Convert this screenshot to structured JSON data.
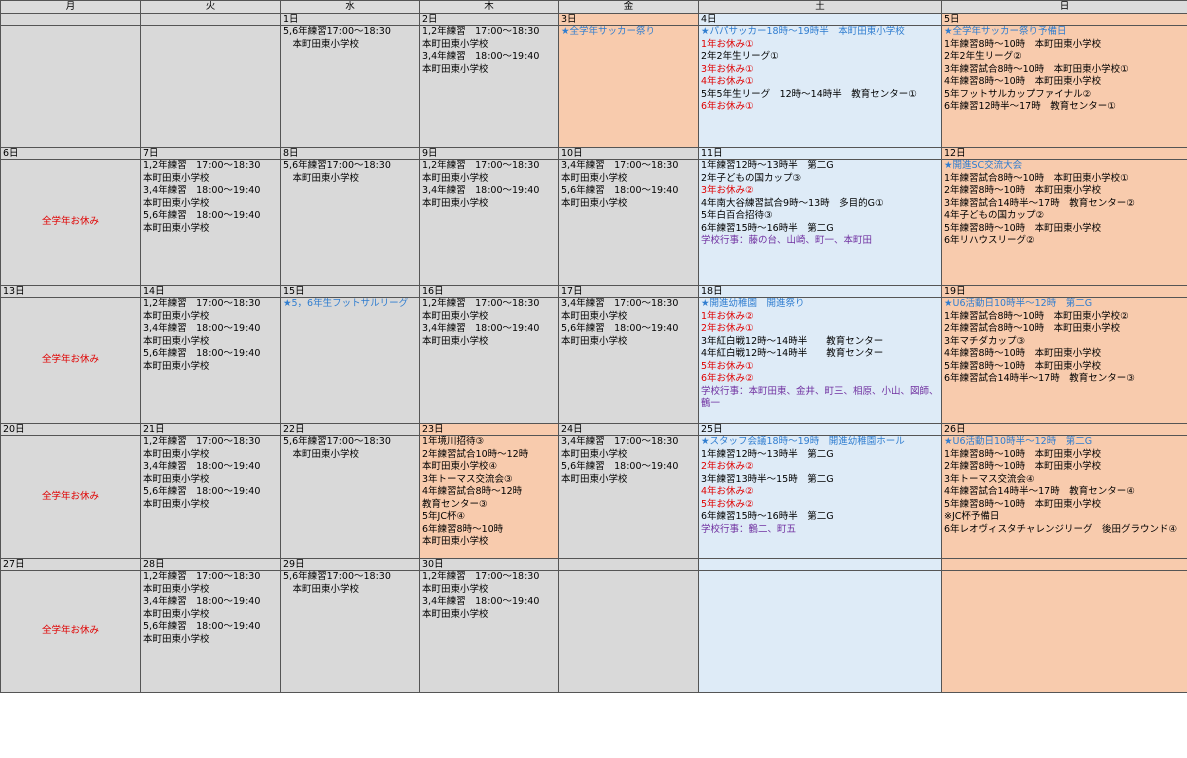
{
  "weekdays": [
    "月",
    "火",
    "水",
    "木",
    "金",
    "土",
    "日"
  ],
  "weeks": [
    {
      "rowHeight": 134,
      "days": [
        {
          "label": "",
          "bg": "gray",
          "lines": []
        },
        {
          "label": "",
          "bg": "gray",
          "lines": []
        },
        {
          "label": "1日",
          "bg": "gray",
          "lines": [
            [
              "5,6年練習17:00～18:30",
              "black"
            ],
            [
              "　本町田東小学校",
              "black"
            ]
          ]
        },
        {
          "label": "2日",
          "bg": "gray",
          "lines": [
            [
              "1,2年練習　17:00～18:30",
              "black"
            ],
            [
              "本町田東小学校",
              "black"
            ],
            [
              "3,4年練習　18:00～19:40",
              "black"
            ],
            [
              "本町田東小学校",
              "black"
            ]
          ]
        },
        {
          "label": "3日",
          "bg": "orange",
          "lines": [
            [
              "★全学年サッカー祭り",
              "blue"
            ]
          ]
        },
        {
          "label": "4日",
          "bg": "blue",
          "lines": [
            [
              "★パパサッカー18時～19時半　本町田東小学校",
              "blue"
            ],
            [
              "1年お休み①",
              "red"
            ],
            [
              "2年2年生リーグ①",
              "black"
            ],
            [
              "3年お休み①",
              "red"
            ],
            [
              "4年お休み①",
              "red"
            ],
            [
              "5年5年生リーグ　12時～14時半　教育センター①",
              "black"
            ],
            [
              "6年お休み①",
              "red"
            ]
          ]
        },
        {
          "label": "5日",
          "bg": "orange",
          "lines": [
            [
              "★全学年サッカー祭り予備日",
              "blue"
            ],
            [
              "1年練習8時～10時　本町田東小学校",
              "black"
            ],
            [
              "2年2年生リーグ②",
              "black"
            ],
            [
              "3年練習試合8時～10時　本町田東小学校①",
              "black"
            ],
            [
              "4年練習8時～10時　本町田東小学校",
              "black"
            ],
            [
              "5年フットサルカップファイナル②",
              "black"
            ],
            [
              "6年練習12時半～17時　教育センター①",
              "black"
            ]
          ]
        }
      ]
    },
    {
      "rowHeight": 138,
      "days": [
        {
          "label": "6日",
          "bg": "gray",
          "center": "全学年お休み",
          "lines": []
        },
        {
          "label": "7日",
          "bg": "gray",
          "lines": [
            [
              "1,2年練習　17:00～18:30",
              "black"
            ],
            [
              "本町田東小学校",
              "black"
            ],
            [
              "3,4年練習　18:00～19:40",
              "black"
            ],
            [
              "本町田東小学校",
              "black"
            ],
            [
              "5,6年練習　18:00～19:40",
              "black"
            ],
            [
              "本町田東小学校",
              "black"
            ]
          ]
        },
        {
          "label": "8日",
          "bg": "gray",
          "lines": [
            [
              "5,6年練習17:00～18:30",
              "black"
            ],
            [
              "　本町田東小学校",
              "black"
            ]
          ]
        },
        {
          "label": "9日",
          "bg": "gray",
          "lines": [
            [
              "1,2年練習　17:00～18:30",
              "black"
            ],
            [
              "本町田東小学校",
              "black"
            ],
            [
              "3,4年練習　18:00～19:40",
              "black"
            ],
            [
              "本町田東小学校",
              "black"
            ]
          ]
        },
        {
          "label": "10日",
          "bg": "gray",
          "lines": [
            [
              "3,4年練習　17:00～18:30",
              "black"
            ],
            [
              "本町田東小学校",
              "black"
            ],
            [
              "5,6年練習　18:00～19:40",
              "black"
            ],
            [
              "本町田東小学校",
              "black"
            ]
          ]
        },
        {
          "label": "11日",
          "bg": "blue",
          "lines": [
            [
              "1年練習12時～13時半　第二G",
              "black"
            ],
            [
              "2年子どもの国カップ③",
              "black"
            ],
            [
              "3年お休み②",
              "red"
            ],
            [
              "4年南大谷練習試合9時～13時　多目的G①",
              "black"
            ],
            [
              "5年白百合招待③",
              "black"
            ],
            [
              "6年練習15時～16時半　第二G",
              "black"
            ],
            [
              "学校行事：藤の台、山崎、町一、本町田",
              "purple"
            ]
          ]
        },
        {
          "label": "12日",
          "bg": "orange",
          "lines": [
            [
              "★開進SC交流大会",
              "blue"
            ],
            [
              "1年練習試合8時～10時　本町田東小学校①",
              "black"
            ],
            [
              "2年練習8時～10時　本町田東小学校",
              "black"
            ],
            [
              "3年練習試合14時半～17時　教育センター②",
              "black"
            ],
            [
              "4年子どもの国カップ②",
              "black"
            ],
            [
              "5年練習8時～10時　本町田東小学校",
              "black"
            ],
            [
              "6年リハウスリーグ②",
              "black"
            ]
          ]
        }
      ]
    },
    {
      "rowHeight": 138,
      "days": [
        {
          "label": "13日",
          "bg": "gray",
          "center": "全学年お休み",
          "lines": []
        },
        {
          "label": "14日",
          "bg": "gray",
          "lines": [
            [
              "1,2年練習　17:00～18:30",
              "black"
            ],
            [
              "本町田東小学校",
              "black"
            ],
            [
              "3,4年練習　18:00～19:40",
              "black"
            ],
            [
              "本町田東小学校",
              "black"
            ],
            [
              "5,6年練習　18:00～19:40",
              "black"
            ],
            [
              "本町田東小学校",
              "black"
            ]
          ]
        },
        {
          "label": "15日",
          "bg": "gray",
          "lines": [
            [
              "★5，6年生フットサルリーグ",
              "blue"
            ]
          ]
        },
        {
          "label": "16日",
          "bg": "gray",
          "lines": [
            [
              "1,2年練習　17:00～18:30",
              "black"
            ],
            [
              "本町田東小学校",
              "black"
            ],
            [
              "3,4年練習　18:00～19:40",
              "black"
            ],
            [
              "本町田東小学校",
              "black"
            ]
          ]
        },
        {
          "label": "17日",
          "bg": "gray",
          "lines": [
            [
              "3,4年練習　17:00～18:30",
              "black"
            ],
            [
              "本町田東小学校",
              "black"
            ],
            [
              "5,6年練習　18:00～19:40",
              "black"
            ],
            [
              "本町田東小学校",
              "black"
            ]
          ]
        },
        {
          "label": "18日",
          "bg": "blue",
          "lines": [
            [
              "★開進幼稚園　開進祭り",
              "blue"
            ],
            [
              "1年お休み②",
              "red"
            ],
            [
              "2年お休み①",
              "red"
            ],
            [
              "3年紅白戦12時～14時半　　教育センター",
              "black"
            ],
            [
              "4年紅白戦12時～14時半　　教育センター",
              "black"
            ],
            [
              "5年お休み①",
              "red"
            ],
            [
              "6年お休み②",
              "red"
            ],
            [
              "学校行事：本町田東、金井、町三、相原、小山、図師、鶴一",
              "purple",
              "wrap"
            ]
          ]
        },
        {
          "label": "19日",
          "bg": "orange",
          "lines": [
            [
              "★U6活動日10時半～12時　第二G",
              "blue"
            ],
            [
              "1年練習試合8時～10時　本町田東小学校②",
              "black"
            ],
            [
              "2年練習試合8時～10時　本町田東小学校",
              "black"
            ],
            [
              "3年マチダカップ③",
              "black"
            ],
            [
              "4年練習8時～10時　本町田東小学校",
              "black"
            ],
            [
              "5年練習8時～10時　本町田東小学校",
              "black"
            ],
            [
              "6年練習試合14時半～17時　教育センター③",
              "black"
            ]
          ]
        }
      ]
    },
    {
      "rowHeight": 135,
      "days": [
        {
          "label": "20日",
          "bg": "gray",
          "center": "全学年お休み",
          "lines": []
        },
        {
          "label": "21日",
          "bg": "gray",
          "lines": [
            [
              "1,2年練習　17:00～18:30",
              "black"
            ],
            [
              "本町田東小学校",
              "black"
            ],
            [
              "3,4年練習　18:00～19:40",
              "black"
            ],
            [
              "本町田東小学校",
              "black"
            ],
            [
              "5,6年練習　18:00～19:40",
              "black"
            ],
            [
              "本町田東小学校",
              "black"
            ]
          ]
        },
        {
          "label": "22日",
          "bg": "gray",
          "lines": [
            [
              "5,6年練習17:00～18:30",
              "black"
            ],
            [
              "　本町田東小学校",
              "black"
            ]
          ]
        },
        {
          "label": "23日",
          "bg": "orange",
          "lines": [
            [
              "1年境川招待③",
              "black"
            ],
            [
              "2年練習試合10時～12時",
              "black"
            ],
            [
              "本町田東小学校④",
              "black"
            ],
            [
              "3年トーマス交流会③",
              "black"
            ],
            [
              "4年練習試合8時～12時",
              "black"
            ],
            [
              "教育センター③",
              "black"
            ],
            [
              "5年JC杯④",
              "black"
            ],
            [
              "6年練習8時～10時",
              "black"
            ],
            [
              "本町田東小学校",
              "black"
            ]
          ]
        },
        {
          "label": "24日",
          "bg": "gray",
          "lines": [
            [
              "3,4年練習　17:00～18:30",
              "black"
            ],
            [
              "本町田東小学校",
              "black"
            ],
            [
              "5,6年練習　18:00～19:40",
              "black"
            ],
            [
              "本町田東小学校",
              "black"
            ]
          ]
        },
        {
          "label": "25日",
          "bg": "blue",
          "lines": [
            [
              "★スタッフ会議18時～19時　開進幼稚園ホール",
              "blue"
            ],
            [
              "1年練習12時～13時半　第二G",
              "black"
            ],
            [
              "2年お休み②",
              "red"
            ],
            [
              "3年練習13時半～15時　第二G",
              "black"
            ],
            [
              "4年お休み②",
              "red"
            ],
            [
              "5年お休み②",
              "red"
            ],
            [
              "6年練習15時～16時半　第二G",
              "black"
            ],
            [
              "学校行事：鶴二、町五",
              "purple"
            ]
          ]
        },
        {
          "label": "26日",
          "bg": "orange",
          "lines": [
            [
              "★U6活動日10時半～12時　第二G",
              "blue"
            ],
            [
              "1年練習8時～10時　本町田東小学校",
              "black"
            ],
            [
              "2年練習8時～10時　本町田東小学校",
              "black"
            ],
            [
              "3年トーマス交流会④",
              "black"
            ],
            [
              "4年練習試合14時半～17時　教育センター④",
              "black"
            ],
            [
              "5年練習8時～10時　本町田東小学校",
              "black"
            ],
            [
              "※JC杯予備日",
              "black"
            ],
            [
              "6年レオヴィスタチャレンジリーグ　後田グラウンド④",
              "black"
            ]
          ]
        }
      ]
    },
    {
      "rowHeight": 134,
      "days": [
        {
          "label": "27日",
          "bg": "gray",
          "center": "全学年お休み",
          "lines": []
        },
        {
          "label": "28日",
          "bg": "gray",
          "lines": [
            [
              "1,2年練習　17:00～18:30",
              "black"
            ],
            [
              "本町田東小学校",
              "black"
            ],
            [
              "3,4年練習　18:00～19:40",
              "black"
            ],
            [
              "本町田東小学校",
              "black"
            ],
            [
              "5,6年練習　18:00～19:40",
              "black"
            ],
            [
              "本町田東小学校",
              "black"
            ]
          ]
        },
        {
          "label": "29日",
          "bg": "gray",
          "lines": [
            [
              "5,6年練習17:00～18:30",
              "black"
            ],
            [
              "　本町田東小学校",
              "black"
            ]
          ]
        },
        {
          "label": "30日",
          "bg": "gray",
          "lines": [
            [
              "1,2年練習　17:00～18:30",
              "black"
            ],
            [
              "本町田東小学校",
              "black"
            ],
            [
              "3,4年練習　18:00～19:40",
              "black"
            ],
            [
              "本町田東小学校",
              "black"
            ]
          ]
        },
        {
          "label": "",
          "bg": "gray",
          "lines": []
        },
        {
          "label": "",
          "bg": "blue",
          "lines": []
        },
        {
          "label": "",
          "bg": "orange",
          "lines": []
        }
      ]
    }
  ]
}
